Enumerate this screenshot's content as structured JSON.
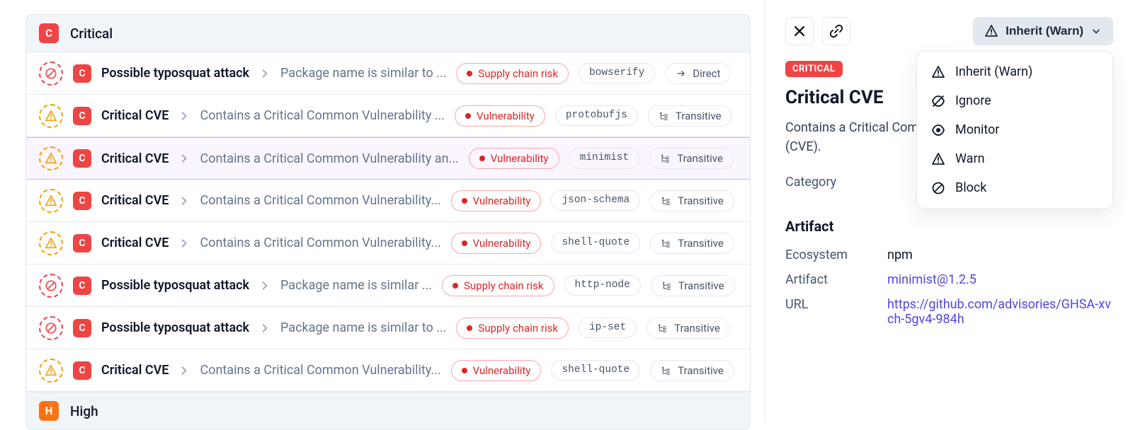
{
  "groups": [
    {
      "id": "critical",
      "label": "Critical",
      "badge": "C",
      "sev": "crit"
    },
    {
      "id": "high",
      "label": "High",
      "badge": "H",
      "sev": "high"
    }
  ],
  "rows": [
    {
      "status": "block",
      "title": "Possible typosquat attack",
      "desc": "Package name is similar to ...",
      "risk": "Supply chain risk",
      "pkg": "bowserify",
      "depType": "Direct",
      "depIcon": "arrow"
    },
    {
      "status": "warn",
      "title": "Critical CVE",
      "desc": "Contains a Critical Common Vulnerability ...",
      "risk": "Vulnerability",
      "pkg": "protobufjs",
      "depType": "Transitive",
      "depIcon": "tree"
    },
    {
      "status": "warn",
      "title": "Critical CVE",
      "desc": "Contains a Critical Common Vulnerability an...",
      "risk": "Vulnerability",
      "pkg": "minimist",
      "depType": "Transitive",
      "depIcon": "tree",
      "selected": true
    },
    {
      "status": "warn",
      "title": "Critical CVE",
      "desc": "Contains a Critical Common Vulnerability...",
      "risk": "Vulnerability",
      "pkg": "json-schema",
      "depType": "Transitive",
      "depIcon": "tree"
    },
    {
      "status": "warn",
      "title": "Critical CVE",
      "desc": "Contains a Critical Common Vulnerability...",
      "risk": "Vulnerability",
      "pkg": "shell-quote",
      "depType": "Transitive",
      "depIcon": "tree"
    },
    {
      "status": "block",
      "title": "Possible typosquat attack",
      "desc": "Package name is similar ...",
      "risk": "Supply chain risk",
      "pkg": "http-node",
      "depType": "Transitive",
      "depIcon": "tree"
    },
    {
      "status": "block",
      "title": "Possible typosquat attack",
      "desc": "Package name is similar to ...",
      "risk": "Supply chain risk",
      "pkg": "ip-set",
      "depType": "Transitive",
      "depIcon": "tree"
    },
    {
      "status": "warn",
      "title": "Critical CVE",
      "desc": "Contains a Critical Common Vulnerability...",
      "risk": "Vulnerability",
      "pkg": "shell-quote",
      "depType": "Transitive",
      "depIcon": "tree"
    }
  ],
  "detail": {
    "severity": "CRITICAL",
    "title": "Critical CVE",
    "desc": "Contains a Critical Common Vulnerability and Exposure (CVE).",
    "category_label": "Category",
    "artifact_heading": "Artifact",
    "ecosystem_label": "Ecosystem",
    "ecosystem_value": "npm",
    "artifact_label": "Artifact",
    "artifact_value": "minimist@1.2.5",
    "url_label": "URL",
    "url_value": "https://github.com/advisories/GHSA-xvch-5gv4-984h"
  },
  "action_button": "Inherit (Warn)",
  "dropdown": [
    {
      "icon": "warn",
      "label": "Inherit (Warn)"
    },
    {
      "icon": "ignore",
      "label": "Ignore"
    },
    {
      "icon": "monitor",
      "label": "Monitor"
    },
    {
      "icon": "warn",
      "label": "Warn"
    },
    {
      "icon": "block",
      "label": "Block"
    }
  ]
}
